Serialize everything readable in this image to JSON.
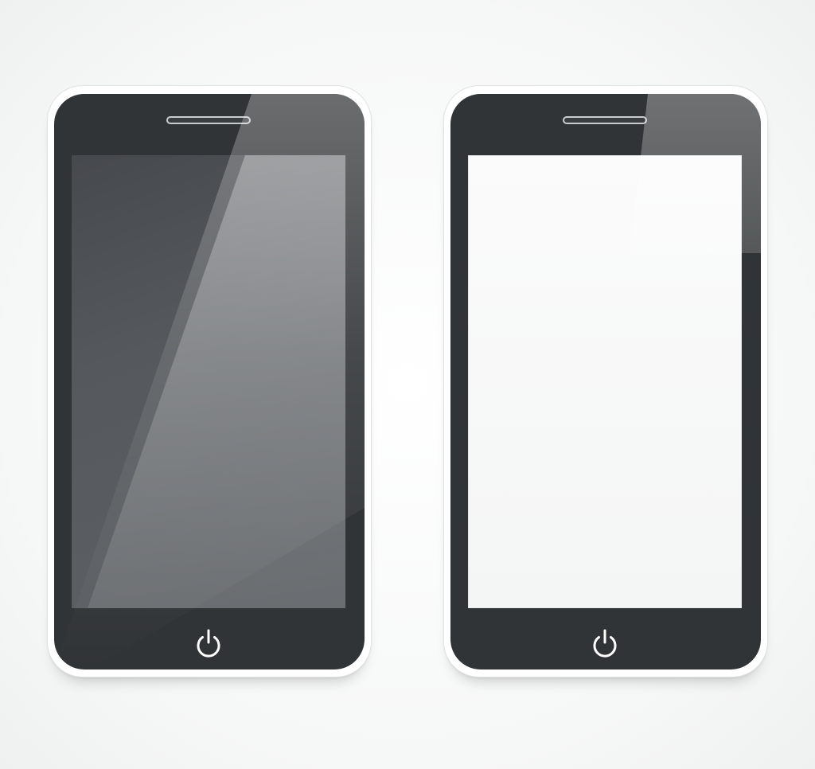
{
  "devices": [
    {
      "screen_state": "off",
      "screen_color": "#55595d"
    },
    {
      "screen_state": "on",
      "screen_color": "#f6f7f7"
    }
  ],
  "icons": {
    "speaker": "speaker-grille-icon",
    "power": "power-icon"
  },
  "colors": {
    "body": "#313436",
    "frame": "#ffffff",
    "background": "#f5f6f6"
  }
}
